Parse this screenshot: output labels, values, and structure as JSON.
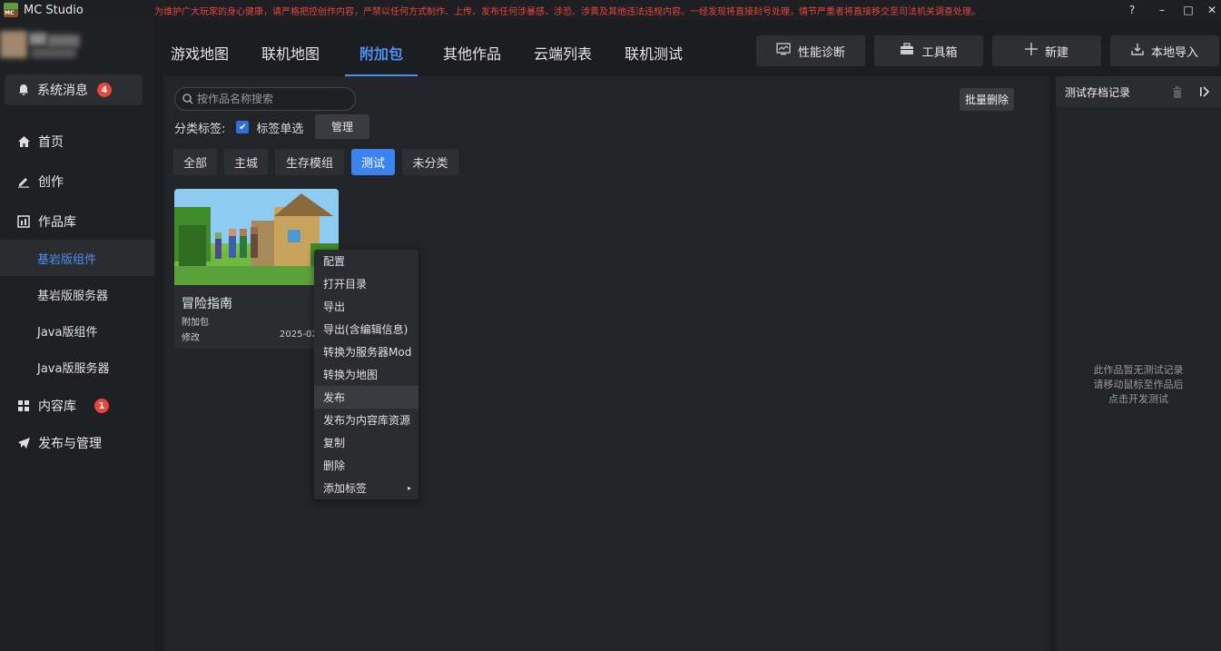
{
  "app": {
    "name": "MC Studio",
    "logo_text": "MC",
    "notice": "为维护广大玩家的身心健康，请严格把控创作内容，严禁以任何方式制作、上传、发布任何涉暴感、涉恐、涉黄及其他违法违规内容。一经发现将直接封号处理，情节严重者将直接移交至司法机关调查处理。",
    "window_controls": [
      "?",
      "–",
      "□",
      "✕"
    ]
  },
  "colors": {
    "accent": "#4a8ff0",
    "danger": "#e8453c",
    "bg": "#1c1d20"
  },
  "sidebar": {
    "system_message": {
      "label": "系统消息",
      "badge": "4"
    },
    "nav": [
      {
        "label": "首页",
        "icon": "home-icon"
      },
      {
        "label": "创作",
        "icon": "edit-icon"
      },
      {
        "label": "作品库",
        "icon": "library-icon"
      }
    ],
    "sub_items": [
      "基岩版组件",
      "基岩版服务器",
      "Java版组件",
      "Java版服务器"
    ],
    "active_sub": "基岩版组件",
    "content_library": {
      "label": "内容库",
      "badge": "1"
    },
    "publish": {
      "label": "发布与管理"
    }
  },
  "tabs": [
    "游戏地图",
    "联机地图",
    "附加包",
    "其他作品",
    "云端列表",
    "联机测试"
  ],
  "active_tab": "附加包",
  "tools": [
    {
      "label": "性能诊断",
      "icon": "diagnose-icon"
    },
    {
      "label": "工具箱",
      "icon": "toolbox-icon"
    },
    {
      "label": "新建",
      "icon": "plus-icon"
    },
    {
      "label": "本地导入",
      "icon": "import-icon"
    }
  ],
  "main": {
    "search_placeholder": "按作品名称搜索",
    "batch_delete": "批量删除",
    "category_label": "分类标签:",
    "single_select": "标签单选",
    "manage": "管理",
    "categories": [
      "全部",
      "主城",
      "生存模组",
      "测试",
      "未分类"
    ],
    "active_category": "测试",
    "card": {
      "title": "冒险指南",
      "type": "附加包",
      "modified_label": "修改",
      "date": "2025-02"
    }
  },
  "context_menu": {
    "items": [
      "配置",
      "打开目录",
      "导出",
      "导出(含编辑信息)",
      "转换为服务器Mod",
      "转换为地图",
      "发布",
      "发布为内容库资源",
      "复制",
      "删除",
      "添加标签"
    ],
    "hovered": "发布",
    "submenu_arrow": "▸"
  },
  "right_panel": {
    "title": "测试存档记录",
    "empty_lines": [
      "此作品暂无测试记录",
      "请移动鼠标至作品后",
      "点击开发测试"
    ]
  }
}
